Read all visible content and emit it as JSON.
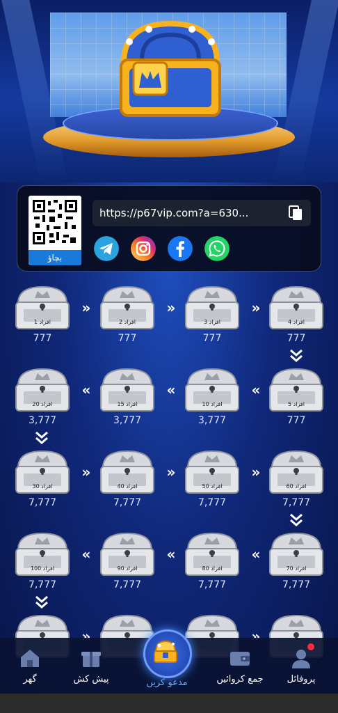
{
  "share": {
    "link": "https://p67vip.com?a=630...",
    "qr_save": "بچاؤ",
    "social": [
      "telegram-icon",
      "instagram-icon",
      "facebook-icon",
      "whatsapp-icon"
    ]
  },
  "chests": [
    {
      "label": "افراد 1",
      "amount": "777"
    },
    {
      "label": "افراد 2",
      "amount": "777"
    },
    {
      "label": "افراد 3",
      "amount": "777"
    },
    {
      "label": "افراد 4",
      "amount": "777"
    },
    {
      "label": "افراد 20",
      "amount": "3,777"
    },
    {
      "label": "افراد 15",
      "amount": "3,777"
    },
    {
      "label": "افراد 10",
      "amount": "3,777"
    },
    {
      "label": "افراد 5",
      "amount": "777"
    },
    {
      "label": "افراد 30",
      "amount": "7,777"
    },
    {
      "label": "افراد 40",
      "amount": "7,777"
    },
    {
      "label": "افراد 50",
      "amount": "7,777"
    },
    {
      "label": "افراد 60",
      "amount": "7,777"
    },
    {
      "label": "افراد 100",
      "amount": "7,777"
    },
    {
      "label": "افراد 90",
      "amount": "7,777"
    },
    {
      "label": "افراد 80",
      "amount": "7,777"
    },
    {
      "label": "افراد 70",
      "amount": "7,777"
    }
  ],
  "nav": {
    "home": "گھر",
    "offer": "پیش کش",
    "invite": "مدعو کریں",
    "deposit": "جمع کروائیں",
    "profile": "پروفائل"
  },
  "colors": {
    "accent": "#1a7ad9",
    "badge": "#ff2a40"
  }
}
